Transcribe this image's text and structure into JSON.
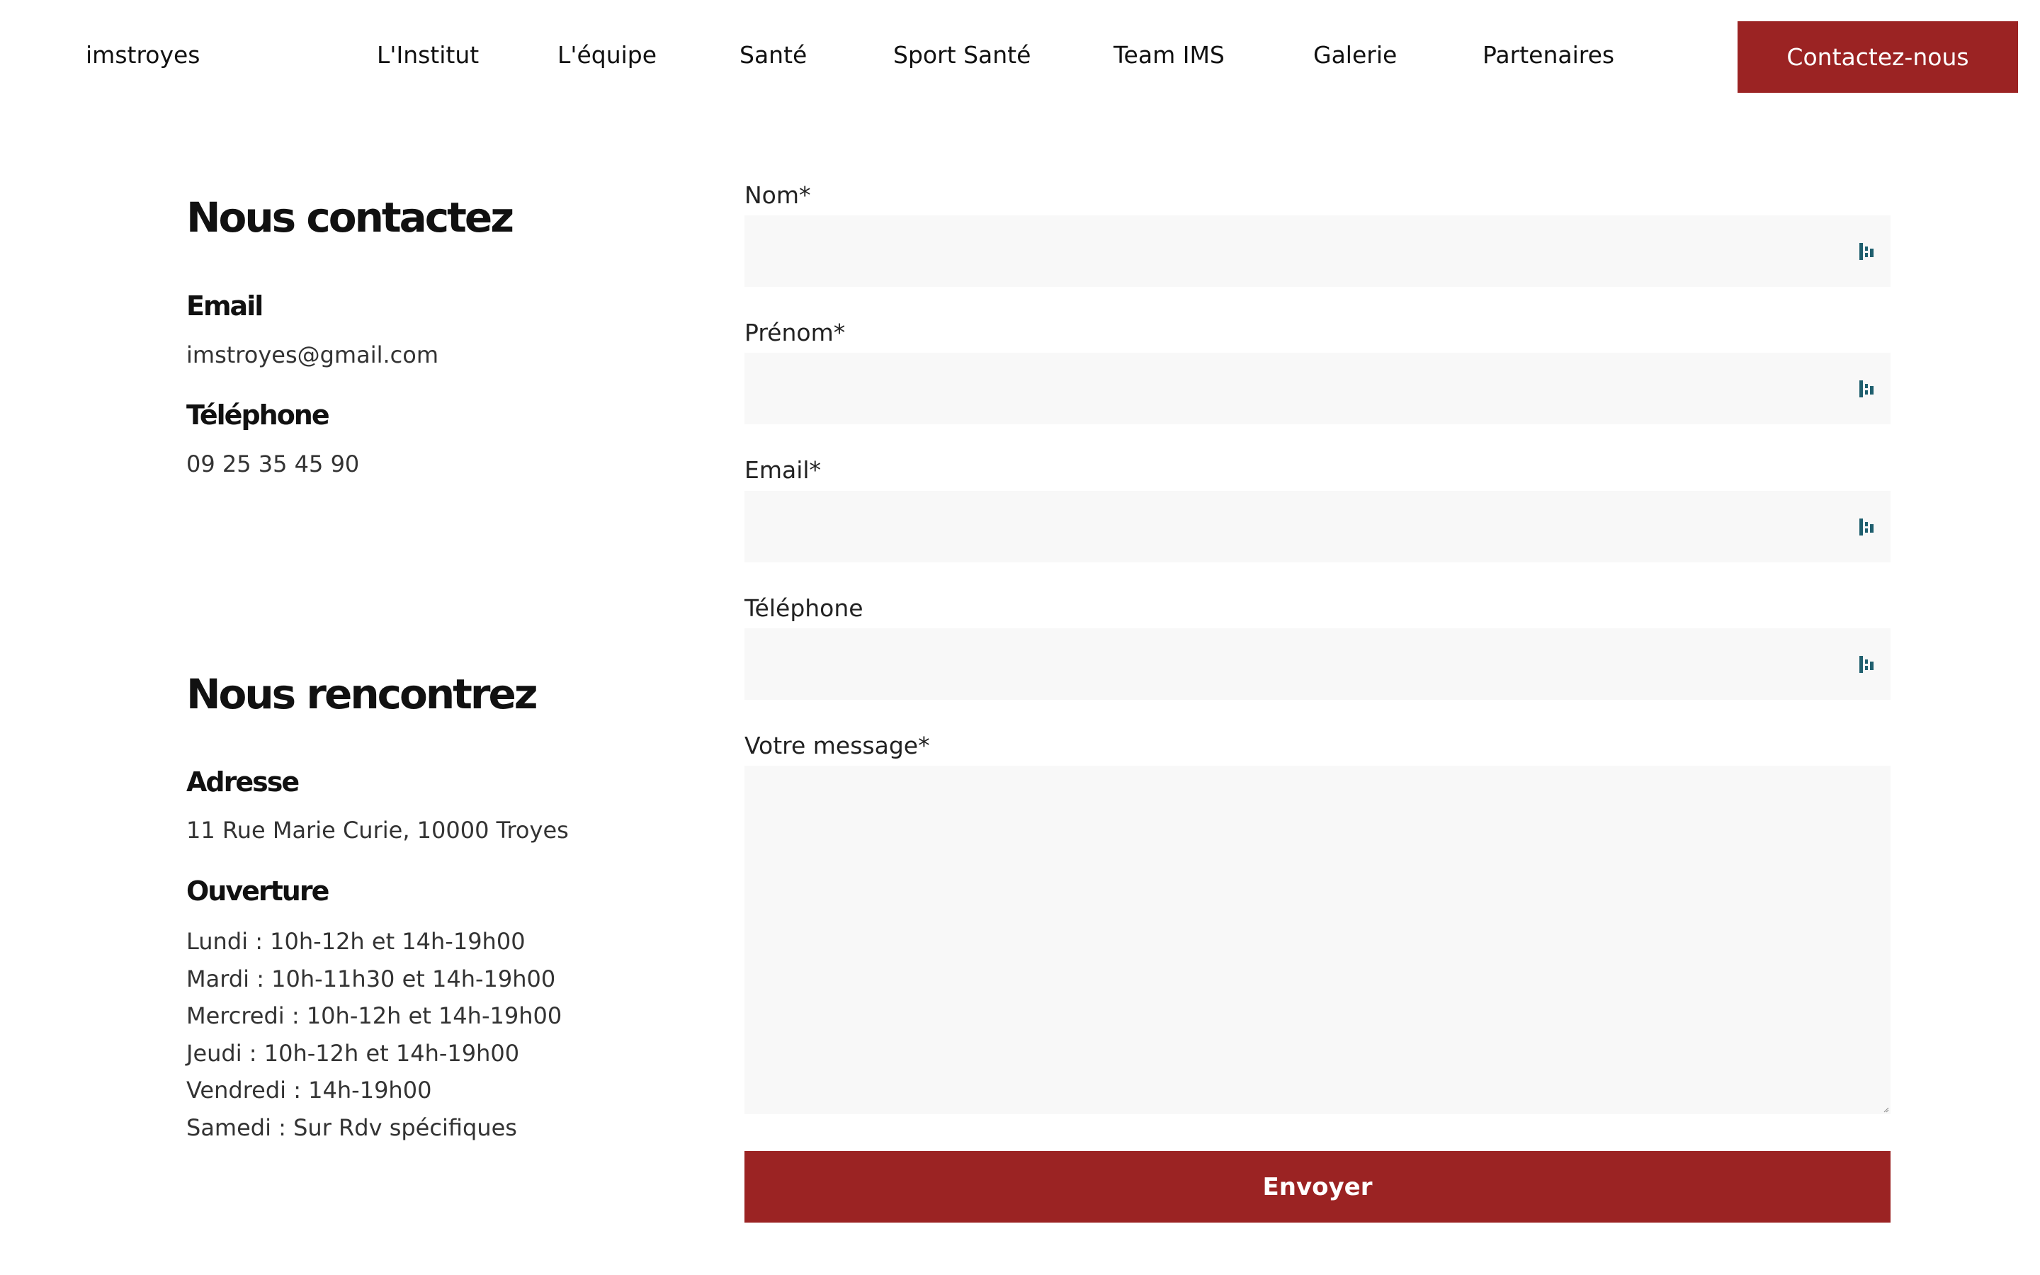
{
  "header": {
    "logo": "imstroyes",
    "nav": [
      {
        "label": "L'Institut"
      },
      {
        "label": "L'équipe"
      },
      {
        "label": "Santé"
      },
      {
        "label": "Sport Santé"
      },
      {
        "label": "Team IMS"
      },
      {
        "label": "Galerie"
      },
      {
        "label": "Partenaires"
      }
    ],
    "cta_label": "Contactez-nous"
  },
  "contact": {
    "title": "Nous contactez",
    "email_label": "Email",
    "email_value": "imstroyes@gmail.com",
    "phone_label": "Téléphone",
    "phone_value": "09 25 35 45 90"
  },
  "visit": {
    "title": "Nous rencontrez",
    "address_label": "Adresse",
    "address_value": "11 Rue Marie Curie, 10000 Troyes",
    "hours_label": "Ouverture",
    "hours": [
      "Lundi : 10h-12h et 14h-19h00",
      "Mardi : 10h-11h30 et 14h-19h00",
      "Mercredi : 10h-12h et 14h-19h00",
      "Jeudi : 10h-12h et 14h-19h00",
      "Vendredi : 14h-19h00",
      "Samedi : Sur Rdv spécifiques"
    ]
  },
  "form": {
    "fields": [
      {
        "label": "Nom*",
        "value": ""
      },
      {
        "label": "Prénom*",
        "value": ""
      },
      {
        "label": "Email*",
        "value": ""
      },
      {
        "label": "Téléphone",
        "value": ""
      }
    ],
    "message_label": "Votre message*",
    "message_value": "",
    "submit_label": "Envoyer"
  },
  "colors": {
    "accent": "#9b2323",
    "field_bg": "#f8f8f8",
    "icon": "#1f5f6e"
  },
  "icons": {
    "field_icon": "password-manager-key-icon"
  }
}
